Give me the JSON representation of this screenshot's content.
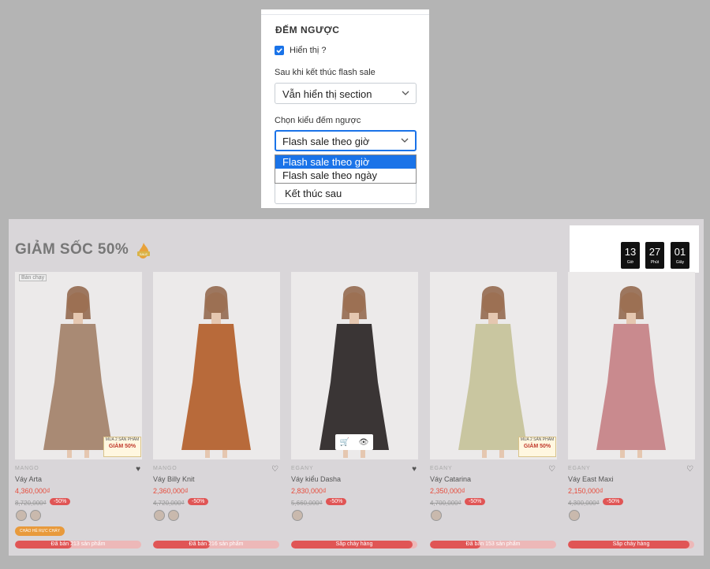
{
  "panel": {
    "title": "ĐẾM NGƯỢC",
    "show_label": "Hiển thị ?",
    "show_checked": true,
    "after_label": "Sau khi kết thúc flash sale",
    "after_value": "Vẫn hiển thị section",
    "type_label": "Chọn kiểu đếm ngược",
    "type_value": "Flash sale theo giờ",
    "type_options": [
      "Flash sale theo giờ",
      "Flash sale theo ngày"
    ],
    "hidden_value": "Kết thúc sau"
  },
  "store": {
    "title": "GIẢM SỐC 50%",
    "badge_icon": "flash-sale-fire-icon",
    "countdown": [
      {
        "num": "13",
        "unit": "Giờ"
      },
      {
        "num": "27",
        "unit": "Phút"
      },
      {
        "num": "01",
        "unit": "Giây"
      }
    ],
    "products": [
      {
        "brand": "MANGO",
        "name": "Váy Arta",
        "price": "4,360,000₫",
        "old": "8,720,000₫",
        "discount": "-50%",
        "bestseller": "Bán chạy",
        "promo_top": "MUA 2 SẢN PHẨM",
        "promo_main": "GIẢM 50%",
        "freeship": "CHÀO HÈ RỰC CHÁY",
        "bar_text": "Đã bán 213 sản phẩm",
        "sold_fraction": 0.45,
        "heart": "♥",
        "swatches": 2,
        "dress": "#a98a74"
      },
      {
        "brand": "MANGO",
        "name": "Váy Billy Knit",
        "price": "2,360,000₫",
        "old": "4,720,000₫",
        "discount": "-50%",
        "bar_text": "Đã bán 216 sản phẩm",
        "sold_fraction": 0.45,
        "heart": "♡",
        "swatches": 2,
        "dress": "#b86a3a"
      },
      {
        "brand": "EGANY",
        "name": "Váy kiểu Dasha",
        "price": "2,830,000₫",
        "old": "5,660,000₫",
        "discount": "-50%",
        "bar_text": "Sắp cháy hàng",
        "sold_fraction": 0.96,
        "heart": "♥",
        "swatches": 1,
        "dress": "#3a3535",
        "quick_cart": "🛒",
        "quick_view": "👁"
      },
      {
        "brand": "EGANY",
        "name": "Váy Catarina",
        "price": "2,350,000₫",
        "old": "4,700,000₫",
        "discount": "-50%",
        "promo_top": "MUA 2 SẢN PHẨM",
        "promo_main": "GIẢM 50%",
        "bar_text": "Đã bán 153 sản phẩm",
        "sold_fraction": 0.4,
        "heart": "♡",
        "swatches": 1,
        "dress": "#c9c6a0"
      },
      {
        "brand": "EGANY",
        "name": "Váy East Maxi",
        "price": "2,150,000₫",
        "old": "4,300,000₫",
        "discount": "-50%",
        "bar_text": "Sắp cháy hàng",
        "sold_fraction": 0.96,
        "heart": "♡",
        "swatches": 1,
        "dress": "#c98a8e"
      }
    ]
  }
}
